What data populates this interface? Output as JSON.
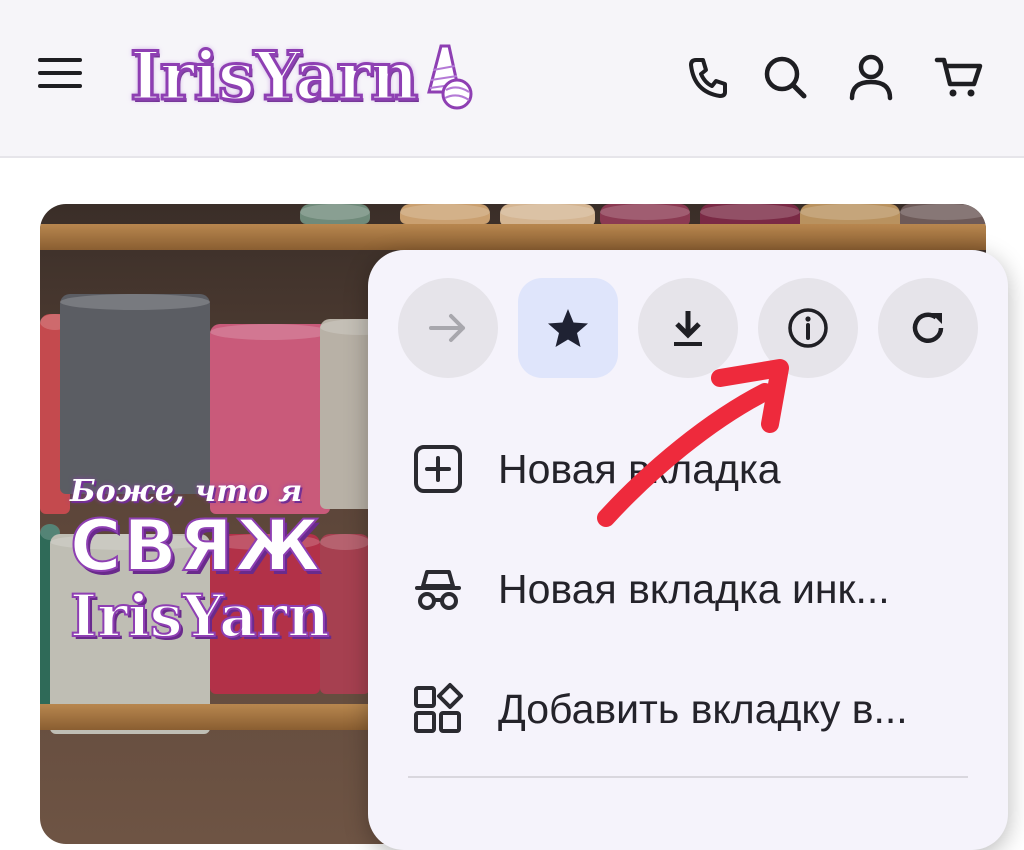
{
  "header": {
    "logo_text": "IrisYarn",
    "icons": [
      "menu-icon",
      "phone-icon",
      "search-icon",
      "account-icon",
      "cart-icon"
    ]
  },
  "hero": {
    "line1": "Боже, что я",
    "line2": "СВЯЖ",
    "line3": "IrisYarn"
  },
  "menu": {
    "toolbar": [
      {
        "name": "forward",
        "icon": "arrow-right-icon",
        "state": "disabled"
      },
      {
        "name": "bookmark",
        "icon": "star-icon",
        "state": "active"
      },
      {
        "name": "download",
        "icon": "download-icon",
        "state": "normal"
      },
      {
        "name": "page-info",
        "icon": "info-icon",
        "state": "normal"
      },
      {
        "name": "reload",
        "icon": "reload-icon",
        "state": "normal"
      }
    ],
    "items": [
      {
        "label": "Новая вкладка",
        "icon": "new-tab-icon"
      },
      {
        "label": "Новая вкладка инк...",
        "icon": "incognito-icon"
      },
      {
        "label": "Добавить вкладку в...",
        "icon": "add-to-group-icon"
      }
    ]
  },
  "colors": {
    "accent_purple": "#8e3fb3",
    "annotation_red": "#ee2a3c",
    "menu_bg": "#f5f3fb"
  }
}
